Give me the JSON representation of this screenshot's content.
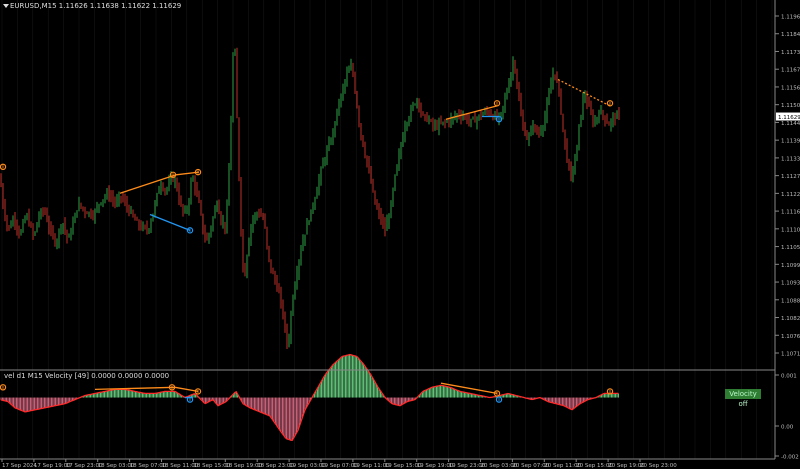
{
  "header": {
    "main_title": "EURUSD,M15  1.11626 1.11638 1.11622 1.11629",
    "sub_title": "vel d1 M15 Velocity [49] 0.0000 0.0000 0.0000",
    "badge": "Velocity off"
  },
  "colors": {
    "background": "#000000",
    "bull": "#2ea043",
    "bear": "#c0302a",
    "grid": "#1b1b1b",
    "axis": "#888888",
    "up_line": "#ff8c1a",
    "down_line": "#2196f3",
    "hist_up": "#6fe08a",
    "hist_down": "#e8718c",
    "vel_line": "#ff2a2a",
    "price_label_bg": "#ffffff"
  },
  "chart_data": [
    {
      "type": "candlestick",
      "symbol": "EURUSD",
      "timeframe": "M15",
      "y_ticks": [
        "1.11960",
        "1.11845",
        "1.11730",
        "1.11675",
        "1.11560",
        "1.11505",
        "1.11440",
        "1.11390",
        "1.11335",
        "1.11275",
        "1.11220",
        "1.11165",
        "1.11105",
        "1.11050",
        "1.10995",
        "1.10935",
        "1.10880",
        "1.10825",
        "1.10765",
        "1.10710"
      ],
      "current_price": "1.11629",
      "x_ticks": [
        "17 Sep 2024",
        "17 Sep 19:00",
        "17 Sep 23:00",
        "18 Sep 03:00",
        "18 Sep 07:00",
        "18 Sep 11:00",
        "18 Sep 15:00",
        "18 Sep 19:00",
        "18 Sep 23:00",
        "19 Sep 03:00",
        "19 Sep 07:00",
        "19 Sep 11:00",
        "19 Sep 15:00",
        "19 Sep 19:00",
        "19 Sep 23:00",
        "20 Sep 03:00",
        "20 Sep 07:00",
        "20 Sep 11:00",
        "20 Sep 15:00",
        "20 Sep 19:00",
        "20 Sep 23:00"
      ],
      "ylim": [
        1.1068,
        1.1204
      ],
      "close_path": [
        [
          0,
          1.114
        ],
        [
          3,
          1.113
        ],
        [
          8,
          1.112
        ],
        [
          14,
          1.1125
        ],
        [
          20,
          1.1118
        ],
        [
          26,
          1.1126
        ],
        [
          30,
          1.1122
        ],
        [
          34,
          1.1117
        ],
        [
          38,
          1.1125
        ],
        [
          44,
          1.1128
        ],
        [
          50,
          1.112
        ],
        [
          56,
          1.1115
        ],
        [
          62,
          1.1124
        ],
        [
          68,
          1.1116
        ],
        [
          72,
          1.1121
        ],
        [
          78,
          1.113
        ],
        [
          86,
          1.1127
        ],
        [
          94,
          1.1126
        ],
        [
          100,
          1.1131
        ],
        [
          108,
          1.1134
        ],
        [
          116,
          1.113
        ],
        [
          121,
          1.1133
        ],
        [
          125,
          1.113
        ],
        [
          130,
          1.1127
        ],
        [
          136,
          1.1123
        ],
        [
          142,
          1.1121
        ],
        [
          148,
          1.112
        ],
        [
          154,
          1.1128
        ],
        [
          160,
          1.1138
        ],
        [
          166,
          1.1135
        ],
        [
          172,
          1.114
        ],
        [
          176,
          1.1138
        ],
        [
          180,
          1.113
        ],
        [
          184,
          1.1126
        ],
        [
          188,
          1.1129
        ],
        [
          192,
          1.1141
        ],
        [
          196,
          1.1135
        ],
        [
          200,
          1.1128
        ],
        [
          203,
          1.112
        ],
        [
          207,
          1.1116
        ],
        [
          212,
          1.1123
        ],
        [
          217,
          1.1131
        ],
        [
          221,
          1.1124
        ],
        [
          226,
          1.1121
        ],
        [
          230,
          1.115
        ],
        [
          234,
          1.1198
        ],
        [
          238,
          1.115
        ],
        [
          241,
          1.112
        ],
        [
          244,
          1.11
        ],
        [
          248,
          1.1115
        ],
        [
          252,
          1.1124
        ],
        [
          258,
          1.1127
        ],
        [
          264,
          1.1124
        ],
        [
          268,
          1.111
        ],
        [
          272,
          1.1104
        ],
        [
          278,
          1.1098
        ],
        [
          283,
          1.1088
        ],
        [
          288,
          1.1075
        ],
        [
          292,
          1.1093
        ],
        [
          297,
          1.1105
        ],
        [
          302,
          1.1115
        ],
        [
          307,
          1.1122
        ],
        [
          312,
          1.1128
        ],
        [
          317,
          1.1136
        ],
        [
          322,
          1.1144
        ],
        [
          327,
          1.115
        ],
        [
          332,
          1.1155
        ],
        [
          337,
          1.1165
        ],
        [
          342,
          1.1172
        ],
        [
          347,
          1.1179
        ],
        [
          352,
          1.1182
        ],
        [
          356,
          1.117
        ],
        [
          360,
          1.1158
        ],
        [
          365,
          1.1149
        ],
        [
          370,
          1.114
        ],
        [
          375,
          1.113
        ],
        [
          380,
          1.1125
        ],
        [
          385,
          1.112
        ],
        [
          390,
          1.1127
        ],
        [
          395,
          1.114
        ],
        [
          400,
          1.115
        ],
        [
          405,
          1.116
        ],
        [
          410,
          1.1164
        ],
        [
          414,
          1.1168
        ],
        [
          418,
          1.117
        ],
        [
          422,
          1.1163
        ],
        [
          428,
          1.1162
        ],
        [
          434,
          1.1159
        ],
        [
          440,
          1.116
        ],
        [
          446,
          1.1161
        ],
        [
          452,
          1.1162
        ],
        [
          458,
          1.1164
        ],
        [
          464,
          1.1163
        ],
        [
          470,
          1.1161
        ],
        [
          476,
          1.1162
        ],
        [
          482,
          1.1164
        ],
        [
          488,
          1.1165
        ],
        [
          494,
          1.1163
        ],
        [
          500,
          1.1162
        ],
        [
          504,
          1.1168
        ],
        [
          509,
          1.1176
        ],
        [
          514,
          1.1185
        ],
        [
          518,
          1.1172
        ],
        [
          522,
          1.116
        ],
        [
          528,
          1.1154
        ],
        [
          533,
          1.116
        ],
        [
          538,
          1.1156
        ],
        [
          544,
          1.1161
        ],
        [
          550,
          1.1173
        ],
        [
          554,
          1.1181
        ],
        [
          559,
          1.1172
        ],
        [
          563,
          1.1158
        ],
        [
          567,
          1.1147
        ],
        [
          571,
          1.114
        ],
        [
          576,
          1.1148
        ],
        [
          580,
          1.1162
        ],
        [
          584,
          1.1172
        ],
        [
          589,
          1.1166
        ],
        [
          594,
          1.116
        ],
        [
          599,
          1.1165
        ],
        [
          604,
          1.1163
        ],
        [
          609,
          1.116
        ],
        [
          614,
          1.1163
        ],
        [
          618,
          1.1163
        ]
      ],
      "trendlines": [
        {
          "color": "up_line",
          "dashed": false,
          "points": [
            [
              120,
              1.1134
            ],
            [
              176,
              1.1141
            ],
            [
              199,
              1.1142
            ]
          ]
        },
        {
          "color": "down_line",
          "dashed": false,
          "points": [
            [
              150,
              1.1126
            ],
            [
              190,
              1.112
            ]
          ]
        },
        {
          "color": "up_line",
          "dashed": false,
          "points": [
            [
              446,
              1.1162
            ],
            [
              497,
              1.1167
            ]
          ]
        },
        {
          "color": "down_line",
          "dashed": false,
          "points": [
            [
              482,
              1.1163
            ],
            [
              499,
              1.1163
            ]
          ]
        },
        {
          "color": "up_line",
          "dashed": true,
          "points": [
            [
              558,
              1.1177
            ],
            [
              610,
              1.1167
            ]
          ]
        }
      ],
      "markers": [
        {
          "x": 3,
          "y": 1.1144,
          "color": "up_line"
        },
        {
          "x": 173,
          "y": 1.1141,
          "color": "up_line"
        },
        {
          "x": 198,
          "y": 1.1142,
          "color": "up_line"
        },
        {
          "x": 190,
          "y": 1.112,
          "color": "down_line"
        },
        {
          "x": 497,
          "y": 1.1168,
          "color": "up_line"
        },
        {
          "x": 499,
          "y": 1.1162,
          "color": "down_line"
        },
        {
          "x": 610,
          "y": 1.1168,
          "color": "up_line"
        }
      ]
    },
    {
      "type": "histogram",
      "name": "Velocity",
      "y_ticks": [
        "0.001",
        "0.00",
        "-0.002"
      ],
      "ylim": [
        -0.0029,
        0.0011
      ],
      "profile": [
        [
          0,
          -0.0001
        ],
        [
          8,
          -0.0002
        ],
        [
          15,
          -0.0005
        ],
        [
          25,
          -0.0007
        ],
        [
          35,
          -0.0006
        ],
        [
          45,
          -0.0005
        ],
        [
          55,
          -0.0004
        ],
        [
          65,
          -0.0003
        ],
        [
          75,
          -0.0001
        ],
        [
          85,
          0.0001
        ],
        [
          95,
          0.0002
        ],
        [
          105,
          0.0003
        ],
        [
          115,
          0.0004
        ],
        [
          125,
          0.0004
        ],
        [
          135,
          0.0003
        ],
        [
          145,
          0.0002
        ],
        [
          155,
          0.0002
        ],
        [
          165,
          0.0003
        ],
        [
          175,
          0.0003
        ],
        [
          185,
          0.0
        ],
        [
          195,
          0.0002
        ],
        [
          205,
          -0.0003
        ],
        [
          213,
          -0.0001
        ],
        [
          218,
          -0.0004
        ],
        [
          226,
          -0.0002
        ],
        [
          236,
          0.0003
        ],
        [
          243,
          -0.0003
        ],
        [
          250,
          -0.0005
        ],
        [
          260,
          -0.0007
        ],
        [
          270,
          -0.0009
        ],
        [
          280,
          -0.0016
        ],
        [
          286,
          -0.002
        ],
        [
          292,
          -0.0021
        ],
        [
          298,
          -0.0016
        ],
        [
          305,
          -0.0006
        ],
        [
          312,
          0.0
        ],
        [
          318,
          0.0005
        ],
        [
          325,
          0.0011
        ],
        [
          333,
          0.0016
        ],
        [
          342,
          0.002
        ],
        [
          350,
          0.0021
        ],
        [
          357,
          0.002
        ],
        [
          364,
          0.0016
        ],
        [
          371,
          0.0011
        ],
        [
          378,
          0.0005
        ],
        [
          385,
          0.0
        ],
        [
          392,
          -0.0003
        ],
        [
          400,
          -0.0004
        ],
        [
          407,
          -0.0002
        ],
        [
          415,
          -0.0001
        ],
        [
          423,
          0.0003
        ],
        [
          432,
          0.0005
        ],
        [
          441,
          0.0006
        ],
        [
          450,
          0.0005
        ],
        [
          460,
          0.0003
        ],
        [
          470,
          0.0002
        ],
        [
          480,
          0.0001
        ],
        [
          490,
          0.0
        ],
        [
          500,
          0.0001
        ],
        [
          508,
          0.0002
        ],
        [
          516,
          0.0001
        ],
        [
          524,
          0.0
        ],
        [
          532,
          -0.0001
        ],
        [
          540,
          0.0
        ],
        [
          548,
          -0.0002
        ],
        [
          556,
          -0.0003
        ],
        [
          564,
          -0.0004
        ],
        [
          572,
          -0.0006
        ],
        [
          580,
          -0.0003
        ],
        [
          588,
          -0.0001
        ],
        [
          596,
          0.0
        ],
        [
          604,
          0.0002
        ],
        [
          612,
          0.0002
        ],
        [
          618,
          0.0002
        ]
      ],
      "trendlines": [
        {
          "color": "up_line",
          "points": [
            [
              95,
              0.0004
            ],
            [
              175,
              0.0005
            ],
            [
              198,
              0.0003
            ]
          ]
        },
        {
          "color": "up_line",
          "points": [
            [
              441,
              0.0007
            ],
            [
              497,
              0.0002
            ]
          ]
        },
        {
          "color": "down_line",
          "points": [
            [
              185,
              0.0
            ],
            [
              193,
              0.0
            ]
          ]
        }
      ],
      "markers": [
        {
          "x": 3,
          "y": 0.0005,
          "color": "up_line"
        },
        {
          "x": 172,
          "y": 0.0005,
          "color": "up_line"
        },
        {
          "x": 198,
          "y": 0.0003,
          "color": "up_line"
        },
        {
          "x": 190,
          "y": -0.0001,
          "color": "down_line"
        },
        {
          "x": 497,
          "y": 0.0002,
          "color": "up_line"
        },
        {
          "x": 499,
          "y": -0.0001,
          "color": "down_line"
        },
        {
          "x": 610,
          "y": 0.0003,
          "color": "up_line"
        }
      ]
    }
  ]
}
